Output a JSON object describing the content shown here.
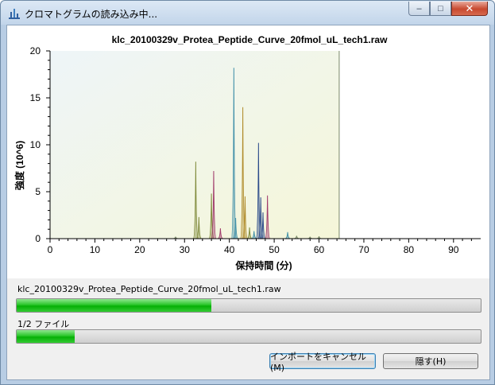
{
  "window": {
    "title": "クロマトグラムの読み込み中...",
    "controls": {
      "minimize": "–",
      "maximize": "□",
      "close": "✕"
    }
  },
  "chart_data": {
    "type": "line",
    "title": "klc_20100329v_Protea_Peptide_Curve_20fmol_uL_tech1.raw",
    "xlabel": "保持時間 (分)",
    "ylabel": "強度 (10^6)",
    "xlim": [
      0,
      95
    ],
    "ylim": [
      0,
      20
    ],
    "xticks": [
      0,
      10,
      20,
      30,
      40,
      50,
      60,
      70,
      80,
      90
    ],
    "yticks": [
      0,
      5,
      10,
      15,
      20
    ],
    "loaded_until_x": 64.5,
    "colors": {
      "olive": "#7f8a3a",
      "teal": "#3f8fa8",
      "brown": "#b08b2a",
      "magenta": "#a03a6a",
      "navy": "#2a4a8a",
      "gray": "#7a8a6a"
    },
    "series": [
      {
        "color": "olive",
        "peaks": [
          [
            32.5,
            8.2
          ],
          [
            33.2,
            2.3
          ],
          [
            36.0,
            4.8
          ],
          [
            44.5,
            1.2
          ]
        ]
      },
      {
        "color": "magenta",
        "peaks": [
          [
            36.5,
            7.2
          ],
          [
            38.0,
            1.1
          ],
          [
            48.5,
            4.6
          ]
        ]
      },
      {
        "color": "teal",
        "peaks": [
          [
            41.0,
            18.2
          ],
          [
            41.4,
            2.2
          ],
          [
            45.5,
            0.8
          ],
          [
            53.0,
            0.7
          ]
        ]
      },
      {
        "color": "brown",
        "peaks": [
          [
            43.0,
            14.0
          ],
          [
            43.5,
            4.5
          ]
        ]
      },
      {
        "color": "navy",
        "peaks": [
          [
            46.5,
            10.2
          ],
          [
            47.0,
            4.4
          ],
          [
            47.5,
            2.8
          ]
        ]
      },
      {
        "color": "gray",
        "peaks": [
          [
            28.0,
            0.2
          ],
          [
            55.0,
            0.3
          ],
          [
            58.0,
            0.2
          ],
          [
            60.0,
            0.25
          ]
        ]
      }
    ]
  },
  "progress": {
    "file_name": "klc_20100329v_Protea_Peptide_Curve_20fmol_uL_tech1.raw",
    "file_fraction": 0.42,
    "file_count_label": "1/2 ファイル",
    "overall_fraction": 0.125
  },
  "buttons": {
    "cancel_import": "インポートをキャンセル(M)",
    "hide": "隠す(H)"
  }
}
